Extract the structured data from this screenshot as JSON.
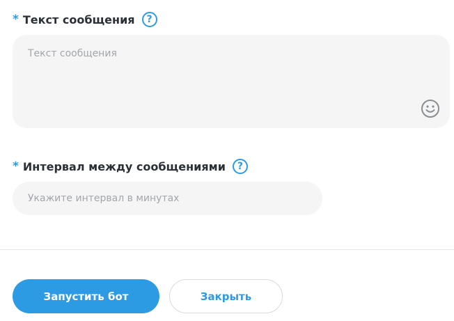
{
  "message_field": {
    "required_mark": "*",
    "label": "Текст сообщения",
    "help_symbol": "?",
    "placeholder": "Текст сообщения",
    "value": "",
    "emoji_icon": "smiley-icon"
  },
  "interval_field": {
    "required_mark": "*",
    "label": "Интервал между сообщениями",
    "help_symbol": "?",
    "placeholder": "Укажите интервал в минутах",
    "value": ""
  },
  "actions": {
    "start_label": "Запустить бот",
    "close_label": "Закрыть"
  },
  "colors": {
    "accent": "#2d9be3",
    "field_bg": "#f5f5f6",
    "label_text": "#2b2f36",
    "placeholder_text": "#a3a6ab",
    "divider": "#e3e4e6"
  }
}
